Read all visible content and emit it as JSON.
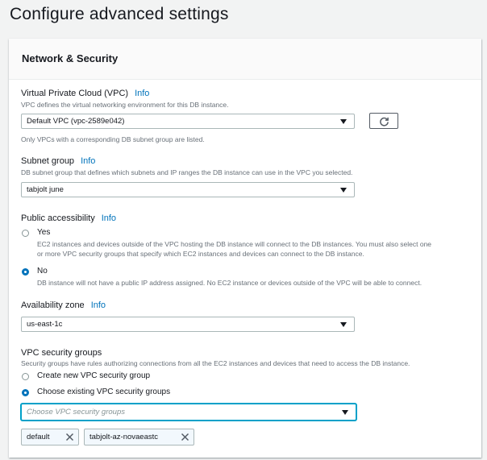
{
  "page": {
    "title": "Configure advanced settings"
  },
  "panel": {
    "title": "Network & Security"
  },
  "vpc": {
    "label": "Virtual Private Cloud (VPC)",
    "info": "Info",
    "description": "VPC defines the virtual networking environment for this DB instance.",
    "selected": "Default VPC (vpc-2589e042)",
    "note": "Only VPCs with a corresponding DB subnet group are listed.",
    "refresh_icon": "refresh-icon"
  },
  "subnet": {
    "label": "Subnet group",
    "info": "Info",
    "description": "DB subnet group that defines which subnets and IP ranges the DB instance can use in the VPC you selected.",
    "selected": "tabjolt june"
  },
  "public_access": {
    "label": "Public accessibility",
    "info": "Info",
    "options": [
      {
        "label": "Yes",
        "checked": false,
        "description_line1": "EC2 instances and devices outside of the VPC hosting the DB instance will connect to the DB instances. You must also select one",
        "description_line2": "or more VPC security groups that specify which EC2 instances and devices can connect to the DB instance."
      },
      {
        "label": "No",
        "checked": true,
        "description_line1": "DB instance will not have a public IP address assigned. No EC2 instance or devices outside of the VPC will be able to connect."
      }
    ]
  },
  "availability_zone": {
    "label": "Availability zone",
    "info": "Info",
    "selected": "us-east-1c"
  },
  "security_groups": {
    "label": "VPC security groups",
    "description": "Security groups have rules authorizing connections from all the EC2 instances and devices that need to access the DB instance.",
    "options": [
      {
        "label": "Create new VPC security group",
        "checked": false
      },
      {
        "label": "Choose existing VPC security groups",
        "checked": true
      }
    ],
    "placeholder": "Choose VPC security groups",
    "tokens": [
      "default",
      "tabjolt-az-novaeastc"
    ]
  },
  "colors": {
    "link": "#0073bb",
    "radio_selected": "#0073bb",
    "focus": "#00a1c9",
    "background": "#f2f3f3"
  }
}
